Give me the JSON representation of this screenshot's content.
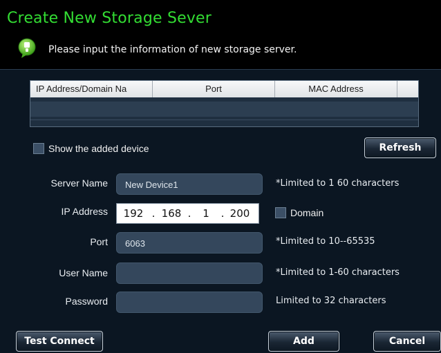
{
  "dialog": {
    "title": "Create New Storage Sever",
    "info_text": "Please input the information of new storage server."
  },
  "table": {
    "columns": [
      "IP Address/Domain Na",
      "Port",
      "MAC Address",
      ""
    ],
    "rows": []
  },
  "show_added": {
    "label": "Show the added device",
    "checked": false
  },
  "refresh_label": "Refresh",
  "form": {
    "server_name": {
      "label": "Server Name",
      "value": "New Device1",
      "hint": "*Limited to 1  60 characters"
    },
    "ip_address": {
      "label": "IP Address",
      "octets": [
        "192",
        "168",
        "1",
        "200"
      ],
      "domain_label": "Domain",
      "domain_checked": false
    },
    "port": {
      "label": "Port",
      "value": "6063",
      "hint": "*Limited to 10--65535"
    },
    "user_name": {
      "label": "User Name",
      "value": "",
      "hint": "*Limited to 1-60 characters"
    },
    "password": {
      "label": "Password",
      "value": "",
      "hint": "Limited to 32 characters"
    }
  },
  "buttons": {
    "test_connect": "Test Connect",
    "add": "Add",
    "cancel": "Cancel"
  },
  "colors": {
    "title": "#33dd33",
    "background": "#0b1622",
    "field": "#34475c"
  },
  "icons": {
    "info": "info-bubble-icon",
    "checkbox": "checkbox-icon"
  }
}
